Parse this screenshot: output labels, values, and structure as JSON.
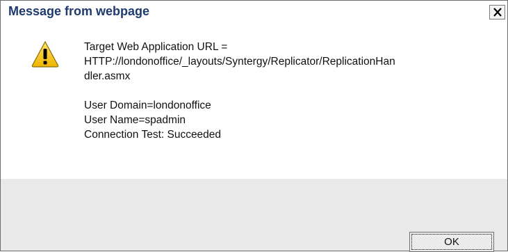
{
  "window": {
    "title": "Message from webpage"
  },
  "icons": {
    "warning": "warning-icon",
    "close": "close-icon"
  },
  "message": {
    "lines": [
      "Target Web Application URL =",
      "HTTP://londonoffice/_layouts/Syntergy/Replicator/ReplicationHan",
      "dler.asmx",
      "",
      "User Domain=londonoffice",
      "User Name=spadmin",
      "Connection Test: Succeeded"
    ]
  },
  "buttons": {
    "ok_label": "OK"
  },
  "colors": {
    "title": "#1f3a6e",
    "footer": "#e9e9e9",
    "warning": "#f5c400"
  }
}
